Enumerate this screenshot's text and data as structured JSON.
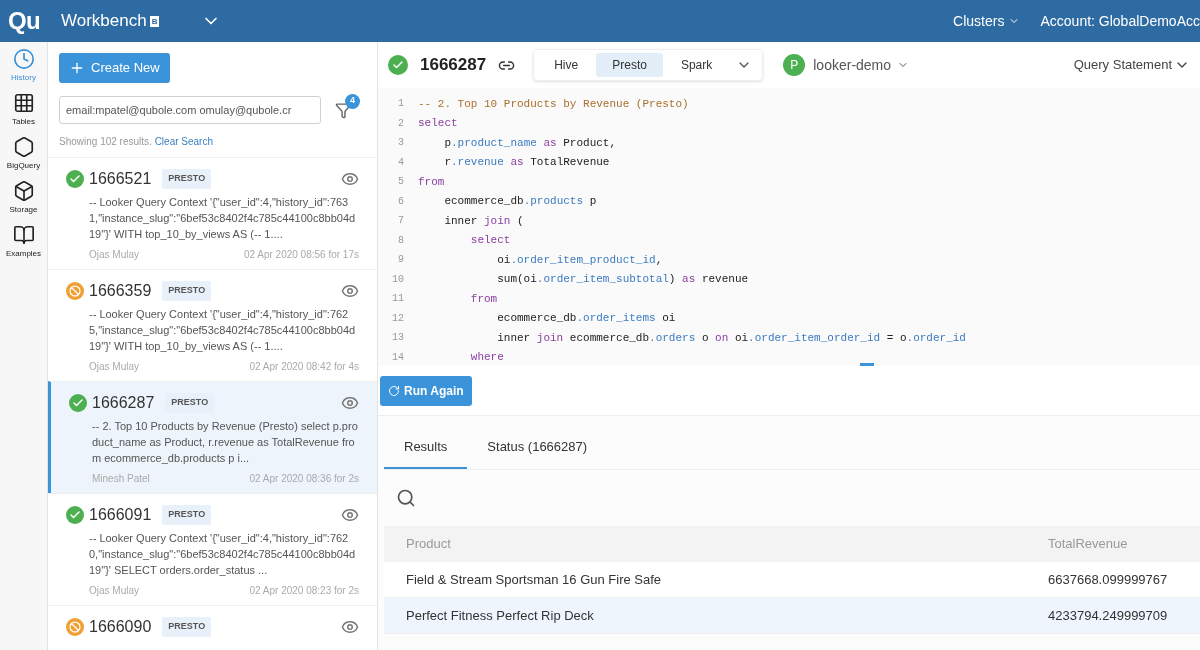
{
  "header": {
    "logo": "Qu",
    "title": "Workbench",
    "badge": "B",
    "menus": [
      {
        "label": "Clusters"
      },
      {
        "label": "Account: GlobalDemoAcc"
      }
    ]
  },
  "rail": [
    {
      "label": "History",
      "selected": true
    },
    {
      "label": "Tables",
      "selected": false
    },
    {
      "label": "BigQuery",
      "selected": false
    },
    {
      "label": "Storage",
      "selected": false
    },
    {
      "label": "Examples",
      "selected": false
    }
  ],
  "history": {
    "create_button": "Create New",
    "search": {
      "value": "email:mpatel@qubole.com omulay@qubole.cr"
    },
    "filter_count": "4",
    "summary": "Showing 102 results.",
    "clear_link": "Clear Search",
    "items": [
      {
        "id": "1666521",
        "engine": "PRESTO",
        "kind": "success",
        "selected": false,
        "query": "-- Looker Query Context '{\"user_id\":4,\"history_id\":7631,\"instance_slug\":\"6bef53c8402f4c785c44100c8bb04d19\"}' WITH top_10_by_views AS (-- 1....",
        "user": "Ojas Mulay",
        "time": "02 Apr 2020 08:56 for 17s"
      },
      {
        "id": "1666359",
        "engine": "PRESTO",
        "kind": "cancelled",
        "selected": false,
        "query": "-- Looker Query Context '{\"user_id\":4,\"history_id\":7625,\"instance_slug\":\"6bef53c8402f4c785c44100c8bb04d19\"}' WITH top_10_by_views AS (-- 1....",
        "user": "Ojas Mulay",
        "time": "02 Apr 2020 08:42 for 4s"
      },
      {
        "id": "1666287",
        "engine": "PRESTO",
        "kind": "success",
        "selected": true,
        "query": "-- 2. Top 10 Products by Revenue (Presto) select p.product_name as Product, r.revenue as TotalRevenue from ecommerce_db.products p i...",
        "user": "Minesh Patel",
        "time": "02 Apr 2020 08:36 for 2s"
      },
      {
        "id": "1666091",
        "engine": "PRESTO",
        "kind": "success",
        "selected": false,
        "query": "-- Looker Query Context '{\"user_id\":4,\"history_id\":7620,\"instance_slug\":\"6bef53c8402f4c785c44100c8bb04d19\"}' SELECT orders.order_status ...",
        "user": "Ojas Mulay",
        "time": "02 Apr 2020 08:23 for 2s"
      },
      {
        "id": "1666090",
        "engine": "PRESTO",
        "kind": "cancelled",
        "selected": false
      }
    ]
  },
  "query": {
    "kind": "success",
    "id": "1666287",
    "engines": [
      {
        "label": "Hive",
        "selected": false
      },
      {
        "label": "Presto",
        "selected": true
      },
      {
        "label": "Spark",
        "selected": false
      }
    ],
    "cluster": {
      "initial": "P",
      "name": "looker-demo"
    },
    "view_menu": "Query Statement",
    "code": [
      {
        "number": "1",
        "tokens": [
          {
            "kind": "comment",
            "text": "-- 2. Top 10 Products by Revenue (Presto)"
          }
        ]
      },
      {
        "number": "2",
        "tokens": [
          {
            "kind": "keyword",
            "text": "select"
          }
        ]
      },
      {
        "number": "3",
        "tokens": [
          {
            "kind": "plain",
            "text": "    p"
          },
          {
            "kind": "field",
            "text": ".product_name"
          },
          {
            "kind": "keyword",
            "text": " as"
          },
          {
            "kind": "plain",
            "text": " Product,"
          }
        ]
      },
      {
        "number": "4",
        "tokens": [
          {
            "kind": "plain",
            "text": "    r"
          },
          {
            "kind": "field",
            "text": ".revenue"
          },
          {
            "kind": "keyword",
            "text": " as"
          },
          {
            "kind": "plain",
            "text": " TotalRevenue"
          }
        ]
      },
      {
        "number": "5",
        "tokens": [
          {
            "kind": "keyword",
            "text": "from"
          }
        ]
      },
      {
        "number": "6",
        "tokens": [
          {
            "kind": "plain",
            "text": "    ecommerce_db"
          },
          {
            "kind": "field",
            "text": ".products"
          },
          {
            "kind": "plain",
            "text": " p"
          }
        ]
      },
      {
        "number": "7",
        "tokens": [
          {
            "kind": "plain",
            "text": "    inner"
          },
          {
            "kind": "keyword",
            "text": " join"
          },
          {
            "kind": "plain",
            "text": " ("
          }
        ]
      },
      {
        "number": "8",
        "tokens": [
          {
            "kind": "keyword",
            "text": "        select"
          }
        ]
      },
      {
        "number": "9",
        "tokens": [
          {
            "kind": "plain",
            "text": "            oi"
          },
          {
            "kind": "field",
            "text": ".order_item_product_id"
          },
          {
            "kind": "plain",
            "text": ","
          }
        ]
      },
      {
        "number": "10",
        "tokens": [
          {
            "kind": "plain",
            "text": "            sum(oi"
          },
          {
            "kind": "field",
            "text": ".order_item_subtotal"
          },
          {
            "kind": "plain",
            "text": ")"
          },
          {
            "kind": "keyword",
            "text": " as"
          },
          {
            "kind": "plain",
            "text": " revenue"
          }
        ]
      },
      {
        "number": "11",
        "tokens": [
          {
            "kind": "keyword",
            "text": "        from"
          }
        ]
      },
      {
        "number": "12",
        "tokens": [
          {
            "kind": "plain",
            "text": "            ecommerce_db"
          },
          {
            "kind": "field",
            "text": ".order_items"
          },
          {
            "kind": "plain",
            "text": " oi"
          }
        ]
      },
      {
        "number": "13",
        "tokens": [
          {
            "kind": "plain",
            "text": "            inner"
          },
          {
            "kind": "keyword",
            "text": " join"
          },
          {
            "kind": "plain",
            "text": " ecommerce_db"
          },
          {
            "kind": "field",
            "text": ".orders"
          },
          {
            "kind": "plain",
            "text": " o"
          },
          {
            "kind": "keyword",
            "text": " on"
          },
          {
            "kind": "plain",
            "text": " oi"
          },
          {
            "kind": "field",
            "text": ".order_item_order_id"
          },
          {
            "kind": "plain",
            "text": " = o"
          },
          {
            "kind": "field",
            "text": ".order_id"
          }
        ]
      },
      {
        "number": "14",
        "tokens": [
          {
            "kind": "keyword",
            "text": "        where"
          }
        ]
      }
    ],
    "run_button": "Run Again"
  },
  "results": {
    "tabs": [
      {
        "label": "Results",
        "selected": true
      },
      {
        "label": "Status (1666287)",
        "selected": false
      }
    ],
    "table": {
      "columns": [
        "Product",
        "TotalRevenue"
      ],
      "rows": [
        {
          "cells": [
            "Field & Stream Sportsman 16 Gun Fire Safe",
            "6637668.099999767"
          ],
          "selected": false
        },
        {
          "cells": [
            "Perfect Fitness Perfect Rip Deck",
            "4233794.249999709"
          ],
          "selected": true
        }
      ]
    }
  }
}
